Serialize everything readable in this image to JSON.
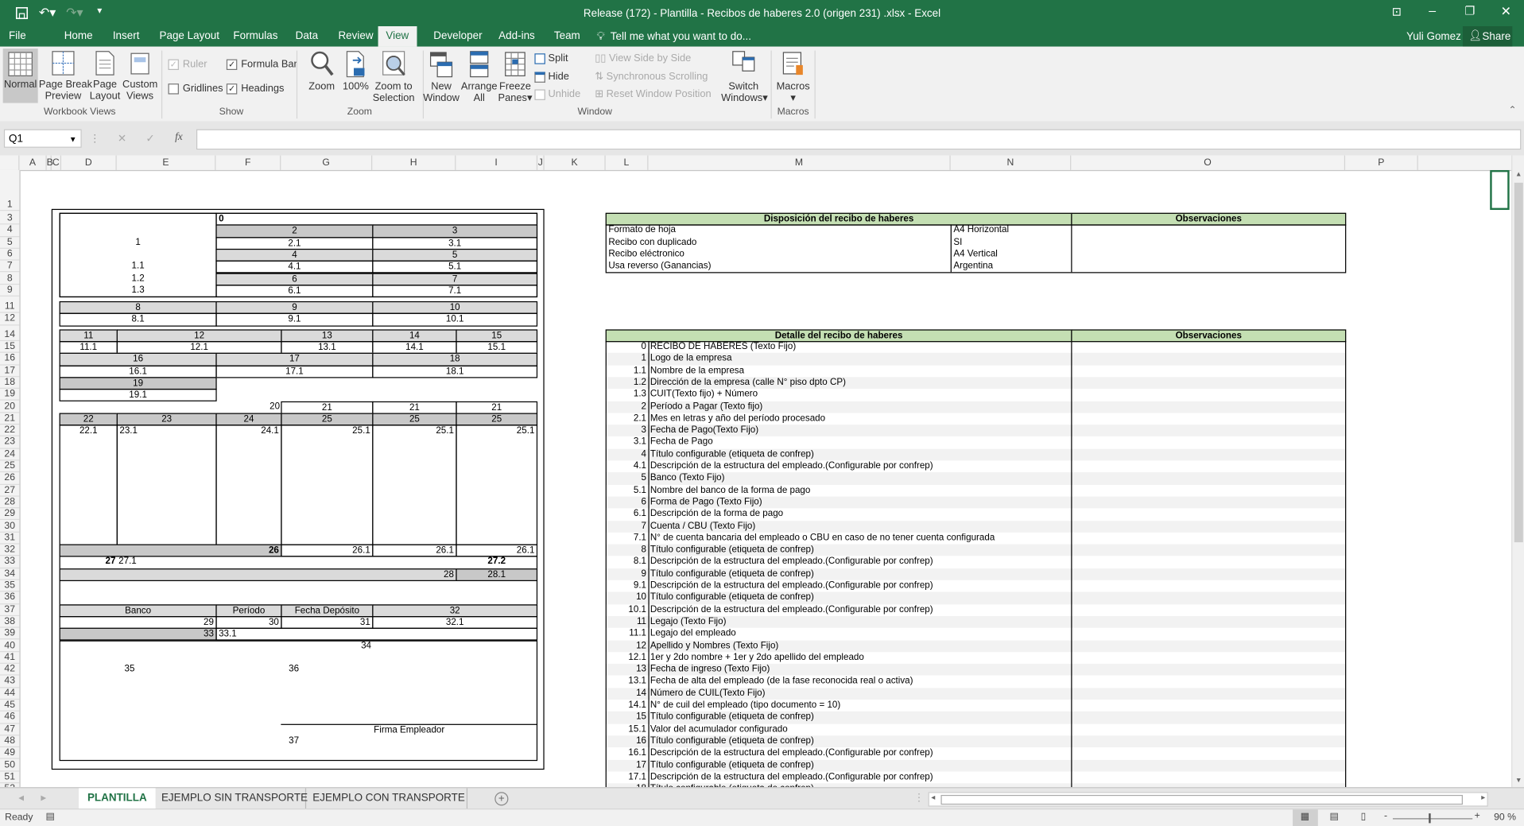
{
  "window": {
    "title": "Release (172) - Plantilla - Recibos de haberes 2.0 (origen 231) .xlsx - Excel",
    "user": "Yuli Gomez",
    "share_label": "Share"
  },
  "colors": {
    "brand": "#217346",
    "table_header": "#c4dfb3",
    "shade_dark": "#c8c8c8",
    "shade_light": "#dadada"
  },
  "ribbon_tabs": [
    "File",
    "Home",
    "Insert",
    "Page Layout",
    "Formulas",
    "Data",
    "Review",
    "View",
    "Developer",
    "Add-ins",
    "Team"
  ],
  "active_tab": "View",
  "tell_me": "Tell me what you want to do...",
  "ribbon": {
    "workbook_views": {
      "label": "Workbook Views",
      "normal": "Normal",
      "page_break_1": "Page Break",
      "page_break_2": "Preview",
      "page_layout_1": "Page",
      "page_layout_2": "Layout",
      "custom_views_1": "Custom",
      "custom_views_2": "Views"
    },
    "show": {
      "label": "Show",
      "ruler": "Ruler",
      "formula_bar": "Formula Bar",
      "gridlines": "Gridlines",
      "headings": "Headings",
      "ruler_checked": true,
      "formula_bar_checked": true,
      "gridlines_checked": false,
      "headings_checked": true
    },
    "zoom": {
      "label": "Zoom",
      "zoom": "Zoom",
      "hundred": "100%",
      "zoom_sel_1": "Zoom to",
      "zoom_sel_2": "Selection"
    },
    "window": {
      "label": "Window",
      "new_1": "New",
      "new_2": "Window",
      "arrange_1": "Arrange",
      "arrange_2": "All",
      "freeze_1": "Freeze",
      "freeze_2": "Panes",
      "split": "Split",
      "hide": "Hide",
      "unhide": "Unhide",
      "side_by_side": "View Side by Side",
      "sync_scroll": "Synchronous Scrolling",
      "reset_pos": "Reset Window Position",
      "switch_1": "Switch",
      "switch_2": "Windows"
    },
    "macros": {
      "label": "Macros",
      "macros": "Macros"
    }
  },
  "formula_bar": {
    "name_box": "Q1",
    "cancel": "✕",
    "enter": "✓",
    "fx": "fx",
    "value": ""
  },
  "columns": [
    "A",
    "B",
    "C",
    "D",
    "E",
    "F",
    "G",
    "H",
    "I",
    "J",
    "K",
    "L",
    "M",
    "N",
    "O",
    "P"
  ],
  "rows": [
    1,
    3,
    4,
    5,
    6,
    7,
    8,
    9,
    11,
    12,
    14,
    15,
    16,
    17,
    18,
    19,
    20,
    21,
    22,
    23,
    24,
    25,
    26,
    27,
    28,
    29,
    30,
    31,
    32,
    33,
    34,
    35,
    36,
    37,
    38,
    39,
    40,
    41,
    42,
    43,
    44,
    45,
    46,
    47,
    48,
    49,
    50,
    51,
    52
  ],
  "template": {
    "cells": [
      "0",
      "1",
      "1.1",
      "1.2",
      "1.3",
      "2",
      "3",
      "2.1",
      "3.1",
      "4",
      "5",
      "4.1",
      "5.1",
      "6",
      "7",
      "6.1",
      "7.1",
      "8",
      "9",
      "10",
      "8.1",
      "9.1",
      "10.1",
      "11",
      "12",
      "13",
      "14",
      "15",
      "11.1",
      "12.1",
      "13.1",
      "14.1",
      "15.1",
      "16",
      "17",
      "18",
      "16.1",
      "17.1",
      "18.1",
      "19",
      "19.1",
      "20",
      "21",
      "21",
      "21",
      "22",
      "23",
      "24",
      "25",
      "25",
      "25",
      "22.1",
      "23.1",
      "24.1",
      "25.1",
      "25.1",
      "25.1",
      "26",
      "26.1",
      "26.1",
      "26.1",
      "27",
      "27.1",
      "27.2",
      "28",
      "28.1",
      "Banco",
      "Período",
      "Fecha Depósito",
      "32",
      "29",
      "30",
      "31",
      "32.1",
      "33",
      "33.1",
      "34",
      "35",
      "36",
      "Firma Empleador",
      "37"
    ]
  },
  "disposicion": {
    "header": "Disposición del recibo de haberes",
    "obs_header": "Observaciones",
    "rows": [
      {
        "label": "Formato de hoja",
        "value": "A4 Horizontal"
      },
      {
        "label": "Recibo con duplicado",
        "value": "SI"
      },
      {
        "label": "Recibo eléctronico",
        "value": "A4 Vertical"
      },
      {
        "label": "Usa reverso (Ganancias)",
        "value": "Argentina"
      }
    ]
  },
  "detalle": {
    "header": "Detalle del recibo de haberes",
    "obs_header": "Observaciones",
    "items": [
      {
        "num": "0",
        "text": "RECIBO DE HABERES (Texto Fijo)"
      },
      {
        "num": "1",
        "text": "Logo de la empresa"
      },
      {
        "num": "1.1",
        "text": "Nombre de la empresa"
      },
      {
        "num": "1.2",
        "text": "Dirección de la empresa (calle N° piso dpto CP)"
      },
      {
        "num": "1.3",
        "text": "CUIT(Texto fijo) + Número"
      },
      {
        "num": "2",
        "text": "Período a Pagar (Texto fijo)"
      },
      {
        "num": "2.1",
        "text": "Mes en letras y año del período procesado"
      },
      {
        "num": "3",
        "text": "Fecha de Pago(Texto Fijo)"
      },
      {
        "num": "3.1",
        "text": "Fecha de Pago"
      },
      {
        "num": "4",
        "text": "Título configurable (etiqueta de confrep)"
      },
      {
        "num": "4.1",
        "text": "Descripción de la estructura del empleado.(Configurable por confrep)"
      },
      {
        "num": "5",
        "text": "Banco (Texto Fijo)"
      },
      {
        "num": "5.1",
        "text": "Nombre del banco de la forma de pago"
      },
      {
        "num": "6",
        "text": "Forma de Pago (Texto Fijo)"
      },
      {
        "num": "6.1",
        "text": "Descripción de la forma de pago"
      },
      {
        "num": "7",
        "text": "Cuenta / CBU (Texto Fijo)"
      },
      {
        "num": "7.1",
        "text": "N° de cuenta bancaria del empleado o CBU en caso de no tener cuenta configurada"
      },
      {
        "num": "8",
        "text": "Título configurable (etiqueta de confrep)"
      },
      {
        "num": "8.1",
        "text": "Descripción de la estructura del empleado.(Configurable por confrep)"
      },
      {
        "num": "9",
        "text": "Título configurable (etiqueta de confrep)"
      },
      {
        "num": "9.1",
        "text": "Descripción de la estructura del empleado.(Configurable por confrep)"
      },
      {
        "num": "10",
        "text": "Título configurable (etiqueta de confrep)"
      },
      {
        "num": "10.1",
        "text": "Descripción de la estructura del empleado.(Configurable por confrep)"
      },
      {
        "num": "11",
        "text": "Legajo (Texto Fijo)"
      },
      {
        "num": "11.1",
        "text": "Legajo del empleado"
      },
      {
        "num": "12",
        "text": "Apellido y Nombres (Texto Fijo)"
      },
      {
        "num": "12.1",
        "text": "1er y 2do nombre + 1er y 2do apellido del empleado"
      },
      {
        "num": "13",
        "text": "Fecha de ingreso (Texto Fijo)"
      },
      {
        "num": "13.1",
        "text": "Fecha de alta del empleado (de la fase reconocida real o activa)"
      },
      {
        "num": "14",
        "text": "Número de CUIL(Texto Fijo)"
      },
      {
        "num": "14.1",
        "text": "N° de cuil del empleado (tipo documento = 10)"
      },
      {
        "num": "15",
        "text": "Título configurable (etiqueta de confrep)"
      },
      {
        "num": "15.1",
        "text": "Valor del acumulador configurado"
      },
      {
        "num": "16",
        "text": "Título configurable (etiqueta de confrep)"
      },
      {
        "num": "16.1",
        "text": "Descripción de la estructura del empleado.(Configurable por confrep)"
      },
      {
        "num": "17",
        "text": "Título configurable (etiqueta de confrep)"
      },
      {
        "num": "17.1",
        "text": "Descripción de la estructura del empleado.(Configurable por confrep)"
      },
      {
        "num": "18",
        "text": "Título configurable (etiqueta de confrep)"
      }
    ]
  },
  "sheet_tabs": {
    "tabs": [
      "PLANTILLA",
      "EJEMPLO SIN TRANSPORTE",
      "EJEMPLO CON TRANSPORTE"
    ],
    "active": "PLANTILLA",
    "add": "+"
  },
  "status": {
    "ready": "Ready",
    "zoom": "90 %",
    "zoom_percent": 90
  }
}
